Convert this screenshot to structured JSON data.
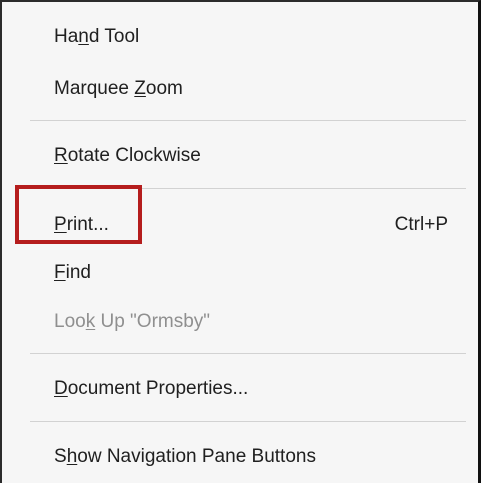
{
  "menu": {
    "items": [
      {
        "pre": "Ha",
        "acc": "n",
        "post": "d Tool"
      },
      {
        "pre": "Marquee ",
        "acc": "Z",
        "post": "oom"
      },
      {
        "pre": "",
        "acc": "R",
        "post": "otate Clockwise"
      },
      {
        "pre": "",
        "acc": "P",
        "post": "rint...",
        "shortcut": "Ctrl+P"
      },
      {
        "pre": "",
        "acc": "F",
        "post": "ind"
      },
      {
        "pre": "Loo",
        "acc": "k",
        "post": " Up \"Ormsby\""
      },
      {
        "pre": "",
        "acc": "D",
        "post": "ocument Properties..."
      },
      {
        "pre": "S",
        "acc": "h",
        "post": "ow Navigation Pane Buttons"
      }
    ]
  },
  "colors": {
    "highlight": "#b51d1d",
    "disabled_text": "#8f8f8f",
    "menu_background": "#f6f6f6"
  }
}
